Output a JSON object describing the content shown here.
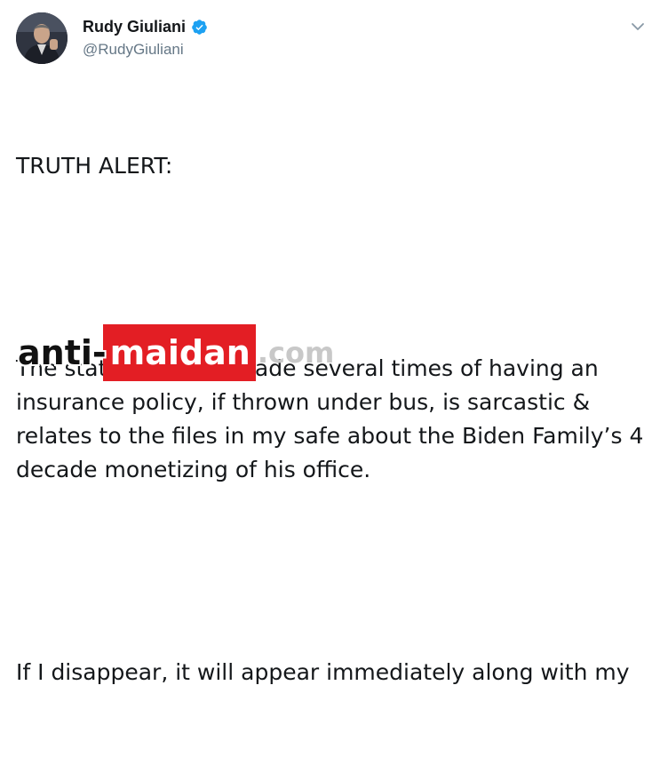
{
  "tweet": {
    "display_name": "Rudy Giuliani",
    "handle": "@RudyGiuliani",
    "verified_icon": "verified-badge-icon",
    "more_icon": "chevron-down-icon",
    "paragraphs": [
      "TRUTH ALERT:",
      "The statement I’ve made several times of having an insurance policy, if thrown under bus, is sarcastic & relates to the files in my safe about the Biden Family’s 4 decade monetizing of his office.",
      "If I disappear, it will appear immediately along with my"
    ]
  },
  "watermark": {
    "part1": "anti-",
    "part2": "maidan",
    "part3": ".com"
  },
  "colors": {
    "text": "#14171a",
    "secondary": "#657786",
    "verified_blue": "#1da1f2",
    "watermark_red": "#e31e24"
  }
}
